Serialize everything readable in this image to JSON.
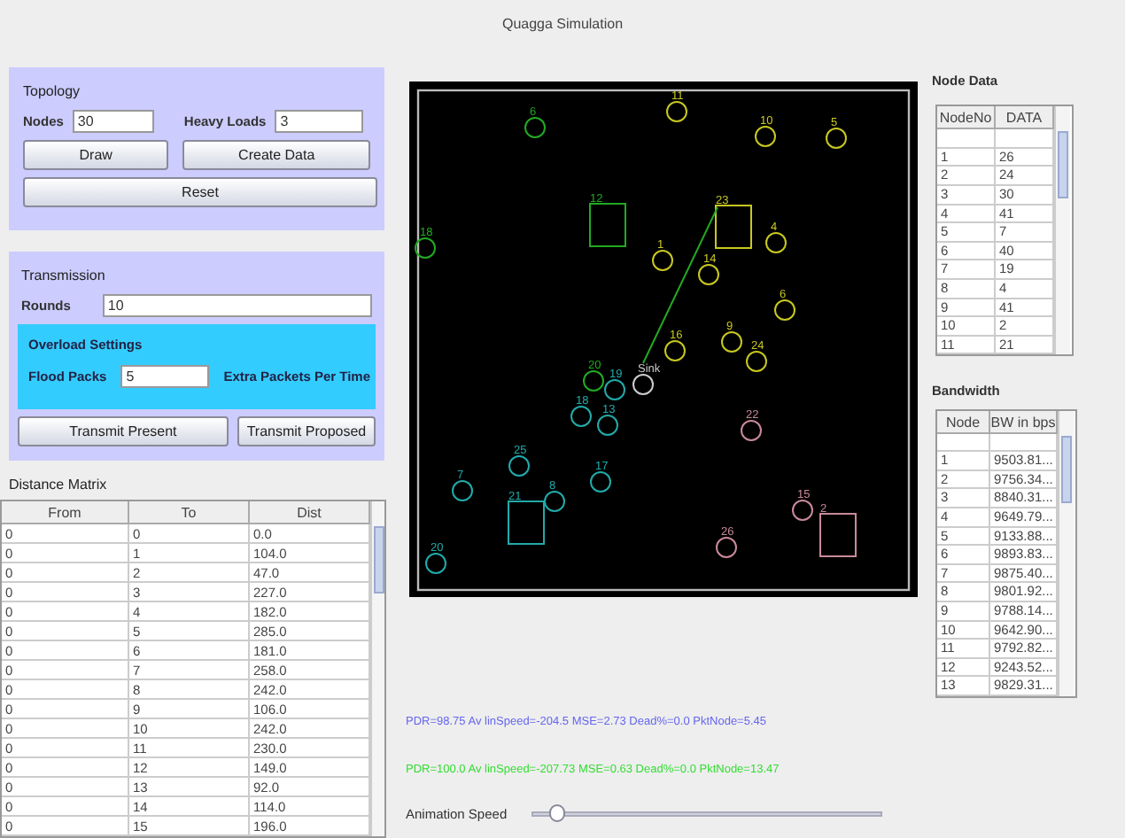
{
  "window": {
    "title": "Quagga Simulation"
  },
  "topology": {
    "title": "Topology",
    "nodes_label": "Nodes",
    "nodes_value": "30",
    "heavy_label": "Heavy Loads",
    "heavy_value": "3",
    "buttons": [
      "Draw",
      "Create Data",
      "Reset"
    ]
  },
  "transmission": {
    "title": "Transmission",
    "rounds_label": "Rounds",
    "rounds_value": "10",
    "overload": {
      "title": "Overload Settings",
      "flood_label": "Flood Packs",
      "flood_value": "5",
      "note": "Extra Packets Per Time"
    },
    "buttons": [
      "Transmit Present",
      "Transmit Proposed"
    ]
  },
  "distance_matrix": {
    "title": "Distance Matrix",
    "columns": [
      "From",
      "To",
      "Dist"
    ],
    "rows": [
      [
        "0",
        "0",
        "0.0"
      ],
      [
        "0",
        "1",
        "104.0"
      ],
      [
        "0",
        "2",
        "47.0"
      ],
      [
        "0",
        "3",
        "227.0"
      ],
      [
        "0",
        "4",
        "182.0"
      ],
      [
        "0",
        "5",
        "285.0"
      ],
      [
        "0",
        "6",
        "181.0"
      ],
      [
        "0",
        "7",
        "258.0"
      ],
      [
        "0",
        "8",
        "242.0"
      ],
      [
        "0",
        "9",
        "106.0"
      ],
      [
        "0",
        "10",
        "242.0"
      ],
      [
        "0",
        "11",
        "230.0"
      ],
      [
        "0",
        "12",
        "149.0"
      ],
      [
        "0",
        "13",
        "92.0"
      ],
      [
        "0",
        "14",
        "114.0"
      ],
      [
        "0",
        "15",
        "196.0"
      ]
    ]
  },
  "network": {
    "nodes": [
      {
        "label": "6",
        "kind": "circle",
        "color": "#22aa22"
      },
      {
        "label": "11",
        "kind": "circle",
        "color": "#c8c820"
      },
      {
        "label": "10",
        "kind": "circle",
        "color": "#c8c820"
      },
      {
        "label": "5",
        "kind": "circle",
        "color": "#c8c820"
      },
      {
        "label": "12",
        "kind": "square",
        "color": "#22aa22"
      },
      {
        "label": "23",
        "kind": "square",
        "color": "#c8c820"
      },
      {
        "label": "18",
        "kind": "circle",
        "color": "#22aa22"
      },
      {
        "label": "1",
        "kind": "circle",
        "color": "#c8c820"
      },
      {
        "label": "4",
        "kind": "circle",
        "color": "#c8c820"
      },
      {
        "label": "14",
        "kind": "circle",
        "color": "#c8c820"
      },
      {
        "label": "6",
        "kind": "circle",
        "color": "#c8c820"
      },
      {
        "label": "16",
        "kind": "circle",
        "color": "#c8c820"
      },
      {
        "label": "9",
        "kind": "circle",
        "color": "#c8c820"
      },
      {
        "label": "24",
        "kind": "circle",
        "color": "#c8c820"
      },
      {
        "label": "20",
        "kind": "circle",
        "color": "#22aa22"
      },
      {
        "label": "Sink",
        "kind": "circle",
        "color": "#cccccc"
      },
      {
        "label": "19",
        "kind": "circle",
        "color": "#22aaaa"
      },
      {
        "label": "18",
        "kind": "circle",
        "color": "#22aaaa"
      },
      {
        "label": "13",
        "kind": "circle",
        "color": "#22aaaa"
      },
      {
        "label": "22",
        "kind": "circle",
        "color": "#c98a9a"
      },
      {
        "label": "25",
        "kind": "circle",
        "color": "#22aaaa"
      },
      {
        "label": "7",
        "kind": "circle",
        "color": "#22aaaa"
      },
      {
        "label": "17",
        "kind": "circle",
        "color": "#22aaaa"
      },
      {
        "label": "21",
        "kind": "square",
        "color": "#22aaaa"
      },
      {
        "label": "8",
        "kind": "circle",
        "color": "#22aaaa"
      },
      {
        "label": "15",
        "kind": "circle",
        "color": "#c98a9a"
      },
      {
        "label": "2",
        "kind": "square",
        "color": "#c98a9a"
      },
      {
        "label": "26",
        "kind": "circle",
        "color": "#c98a9a"
      },
      {
        "label": "20",
        "kind": "circle",
        "color": "#22aaaa"
      }
    ]
  },
  "stats": [
    {
      "text": "PDR=98.75 Av linSpeed=-204.5 MSE=2.73 Dead%=0.0 PktNode=5.45",
      "color": "#6666ee"
    },
    {
      "text": "PDR=100.0 Av linSpeed=-207.73 MSE=0.63 Dead%=0.0 PktNode=13.47",
      "color": "#33dd33"
    }
  ],
  "animation_speed": {
    "label": "Animation Speed",
    "level": 0.05
  },
  "node_data": {
    "title": "Node Data",
    "columns": [
      "NodeNo",
      "DATA"
    ],
    "rows": [
      [
        "",
        ""
      ],
      [
        "1",
        "26"
      ],
      [
        "2",
        "24"
      ],
      [
        "3",
        "30"
      ],
      [
        "4",
        "41"
      ],
      [
        "5",
        "7"
      ],
      [
        "6",
        "40"
      ],
      [
        "7",
        "19"
      ],
      [
        "8",
        "4"
      ],
      [
        "9",
        "41"
      ],
      [
        "10",
        "2"
      ],
      [
        "11",
        "21"
      ]
    ]
  },
  "bandwidth": {
    "title": "Bandwidth",
    "columns": [
      "Node",
      "BW in bps"
    ],
    "rows": [
      [
        "",
        ""
      ],
      [
        "1",
        "9503.81..."
      ],
      [
        "2",
        "9756.34..."
      ],
      [
        "3",
        "8840.31..."
      ],
      [
        "4",
        "9649.79..."
      ],
      [
        "5",
        "9133.88..."
      ],
      [
        "6",
        "9893.83..."
      ],
      [
        "7",
        "9875.40..."
      ],
      [
        "8",
        "9801.92..."
      ],
      [
        "9",
        "9788.14..."
      ],
      [
        "10",
        "9642.90..."
      ],
      [
        "11",
        "9792.82..."
      ],
      [
        "12",
        "9243.52..."
      ],
      [
        "13",
        "9829.31..."
      ]
    ]
  }
}
